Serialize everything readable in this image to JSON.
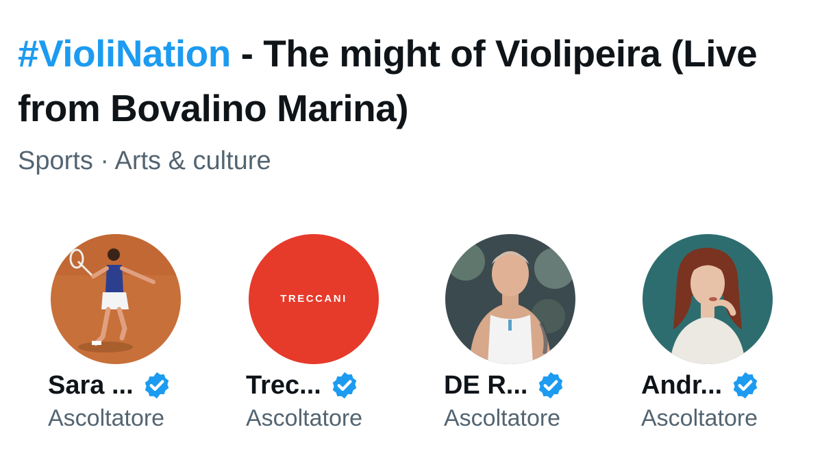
{
  "space": {
    "hashtag": "#VioliNation",
    "title_rest": " - The might of Violipeira (Live from Bovalino Marina)",
    "topics": "Sports · Arts & culture"
  },
  "speakers": [
    {
      "name": "Sara ...",
      "role": "Ascoltatore",
      "verified": true,
      "avatar": "tennis-player-photo"
    },
    {
      "name": "Trec...",
      "role": "Ascoltatore",
      "verified": true,
      "avatar": "treccani-logo",
      "logo_text": "TRECCANI"
    },
    {
      "name": "DE R...",
      "role": "Ascoltatore",
      "verified": true,
      "avatar": "man-in-tank-top-photo"
    },
    {
      "name": "Andr...",
      "role": "Ascoltatore",
      "verified": true,
      "avatar": "woman-portrait-photo"
    }
  ],
  "colors": {
    "accent": "#1d9bf0",
    "text": "#0f1419",
    "secondary_text": "#536471",
    "treccani_red": "#e63a2a"
  }
}
